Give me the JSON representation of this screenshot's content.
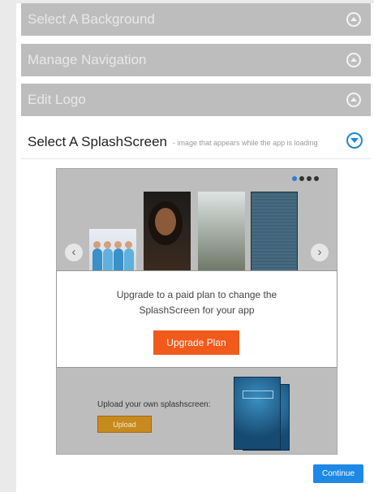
{
  "accordion": {
    "sections": [
      {
        "label": "Select A Background"
      },
      {
        "label": "Manage Navigation"
      },
      {
        "label": "Edit Logo"
      }
    ],
    "active": {
      "label": "Select A SplashScreen",
      "subtitle": "- image that appears while the app is loading"
    }
  },
  "carousel": {
    "pages": 4,
    "current_page": 1,
    "prev_icon": "chevron-left-icon",
    "next_icon": "chevron-right-icon",
    "prev_glyph": "‹",
    "next_glyph": "›"
  },
  "upgrade": {
    "line1": "Upgrade to a paid plan to change the",
    "line2": "SplashScreen for your app",
    "button": "Upgrade Plan"
  },
  "upload": {
    "label": "Upload your own splashscreen:",
    "button": "Upload"
  },
  "footer": {
    "continue": "Continue"
  },
  "colors": {
    "accent": "#1e88e5",
    "upgrade": "#f15a1b",
    "upload": "#c88a1e",
    "collapsed_header": "#bdbdbd"
  }
}
